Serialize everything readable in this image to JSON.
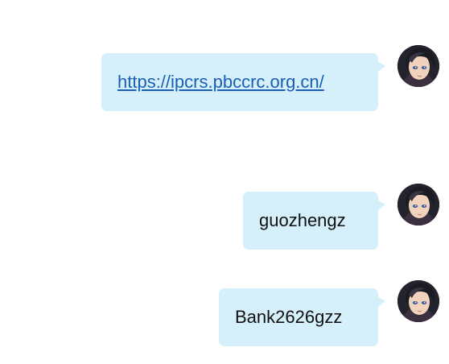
{
  "messages": [
    {
      "type": "link",
      "text": "https://ipcrs.pbccrc.org.cn/",
      "href": "https://ipcrs.pbccrc.org.cn/",
      "avatar": "user-avatar"
    },
    {
      "type": "text",
      "text": "guozhengz",
      "avatar": "user-avatar"
    },
    {
      "type": "text",
      "text": "Bank2626gzz",
      "avatar": "user-avatar"
    }
  ],
  "colors": {
    "bubble": "#d6f0fb",
    "link": "#1a5fb4",
    "text": "#111111",
    "background": "#ffffff"
  }
}
